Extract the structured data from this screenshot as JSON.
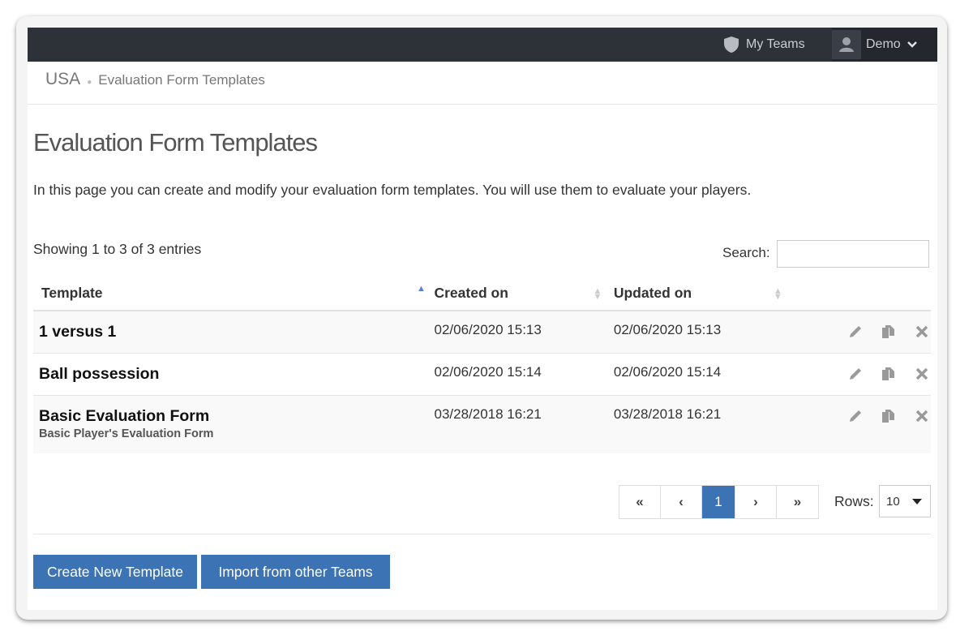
{
  "topbar": {
    "my_teams": "My Teams",
    "user_name": "Demo"
  },
  "breadcrumb": {
    "root": "USA",
    "current": "Evaluation Form Templates"
  },
  "page": {
    "title": "Evaluation Form Templates",
    "description": "In this page you can create and modify your evaluation form templates. You will use them to evaluate your players.",
    "showing": "Showing 1 to 3 of 3 entries",
    "search_label": "Search:",
    "search_value": ""
  },
  "table": {
    "headers": [
      "Template",
      "Created on",
      "Updated on"
    ],
    "rows": [
      {
        "name": "1 versus 1",
        "subtitle": "",
        "created": "02/06/2020 15:13",
        "updated": "02/06/2020 15:13"
      },
      {
        "name": "Ball possession",
        "subtitle": "",
        "created": "02/06/2020 15:14",
        "updated": "02/06/2020 15:14"
      },
      {
        "name": "Basic Evaluation Form",
        "subtitle": "Basic Player's Evaluation Form",
        "created": "03/28/2018 16:21",
        "updated": "03/28/2018 16:21"
      }
    ]
  },
  "pagination": {
    "first": "«",
    "prev": "‹",
    "current": "1",
    "next": "›",
    "last": "»",
    "rows_label": "Rows:",
    "rows_value": "10"
  },
  "buttons": {
    "create": "Create New Template",
    "import": "Import from other Teams"
  },
  "colors": {
    "topbar": "#2d3239",
    "accent": "#3b73b5"
  },
  "icons": {
    "my_teams": "shield-icon",
    "user": "user-avatar-icon",
    "edit": "pencil-icon",
    "copy": "copy-icon",
    "delete": "close-icon"
  }
}
